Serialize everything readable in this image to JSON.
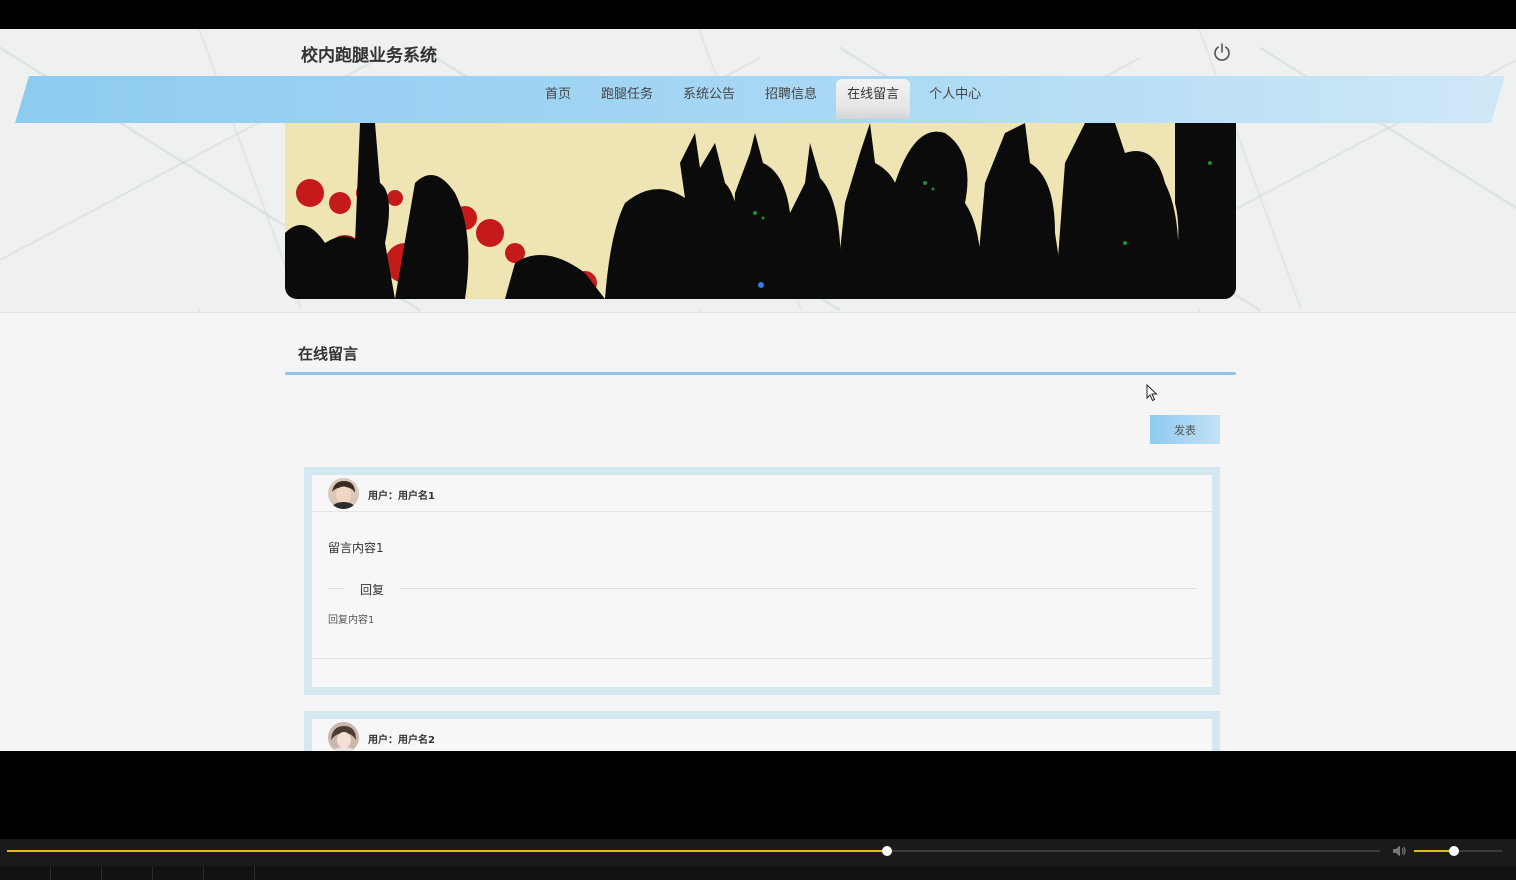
{
  "site": {
    "title": "校内跑腿业务系统"
  },
  "nav": {
    "items": [
      {
        "label": "首页"
      },
      {
        "label": "跑腿任务"
      },
      {
        "label": "系统公告"
      },
      {
        "label": "招聘信息"
      },
      {
        "label": "在线留言"
      },
      {
        "label": "个人中心"
      }
    ],
    "active_index": 4
  },
  "section": {
    "title": "在线留言"
  },
  "post_button": {
    "label": "发表"
  },
  "messages": [
    {
      "user": "用户：用户名1",
      "content": "留言内容1",
      "reply_label": "回复",
      "reply": "回复内容1"
    },
    {
      "user": "用户：用户名2"
    }
  ],
  "colors": {
    "accent": "#8ecbf1",
    "card_border": "#d5e8f1",
    "seek": "#e0b91a"
  },
  "player": {
    "progress": 0.6406,
    "volume": 0.45
  }
}
